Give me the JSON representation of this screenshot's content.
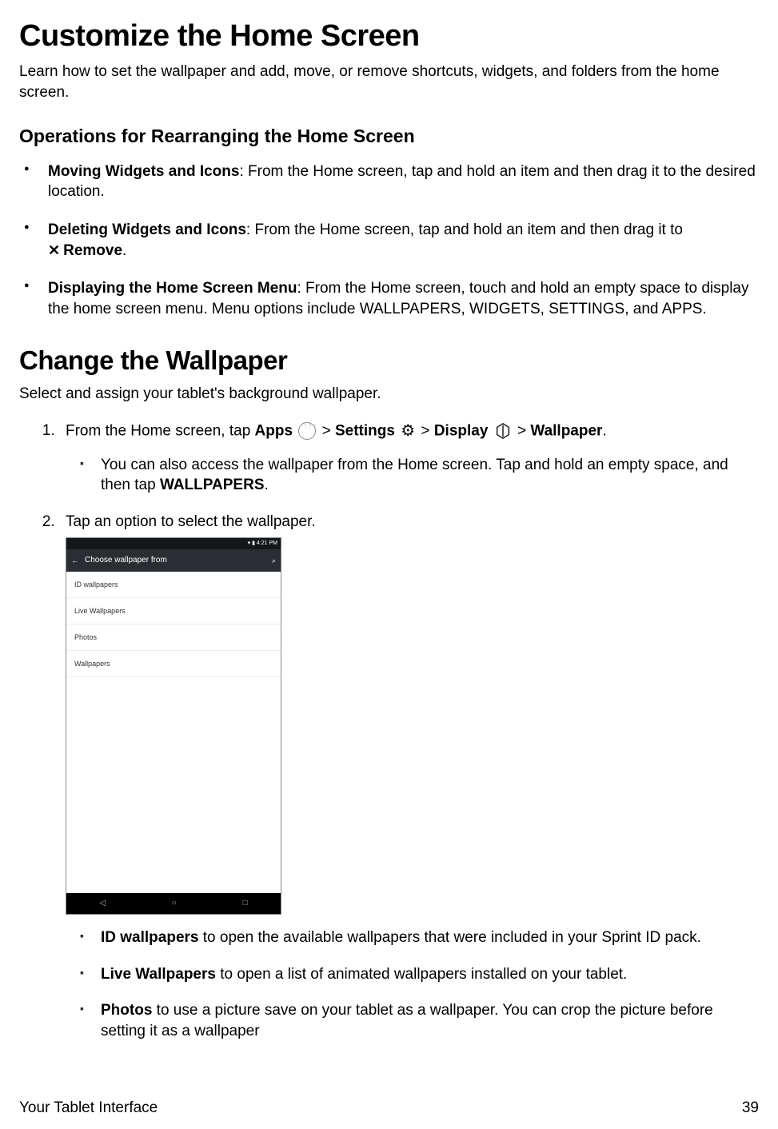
{
  "h1_a": "Customize the Home Screen",
  "intro_a": "Learn how to set the wallpaper and add, move, or remove shortcuts, widgets, and folders from the home screen.",
  "h2_a": "Operations for Rearranging the Home Screen",
  "bullets_a": {
    "b1_strong": "Moving Widgets and Icons",
    "b1_rest": ": From the Home screen, tap and hold an item and then drag it to the desired location.",
    "b2_strong": "Deleting Widgets and Icons",
    "b2_rest_a": ": From the Home screen, tap and hold an item and then drag it to ",
    "b2_remove": "Remove",
    "b2_rest_b": ".",
    "b3_strong": "Displaying the Home Screen Menu",
    "b3_rest": ": From the Home screen, touch and hold an empty space to display the home screen menu. Menu options include WALLPAPERS, WIDGETS, SETTINGS, and APPS."
  },
  "h1_b": "Change the Wallpaper",
  "intro_b": "Select and assign your tablet's background wallpaper.",
  "step1": {
    "pre": "From the Home screen, tap ",
    "apps": "Apps",
    "gt1": " > ",
    "settings": "Settings",
    "gt2": " > ",
    "display": "Display",
    "gt3": " > ",
    "wallpaper": "Wallpaper",
    "post": ".",
    "sub_a": "You can also access the wallpaper from the Home screen. Tap and hold an empty space, and then tap ",
    "sub_b": "WALLPAPERS",
    "sub_c": "."
  },
  "step2": "Tap an option to select the wallpaper.",
  "device": {
    "time": "4:21 PM",
    "status_icons": "▾ ▮",
    "back": "←",
    "title": "Choose wallpaper from",
    "search": "⌕",
    "items": [
      "ID wallpapers",
      "Live Wallpapers",
      "Photos",
      "Wallpapers"
    ],
    "nav": [
      "◁",
      "○",
      "□"
    ]
  },
  "options": {
    "o1_strong": "ID wallpapers",
    "o1_rest": " to open the available wallpapers that were included in your Sprint ID pack.",
    "o2_strong": "Live Wallpapers",
    "o2_rest": " to open a list of animated wallpapers installed on your tablet.",
    "o3_strong": "Photos",
    "o3_rest": " to use a picture save on your tablet as a wallpaper. You can crop the picture before setting it as a wallpaper"
  },
  "footer_left": "Your Tablet Interface",
  "footer_right": "39"
}
